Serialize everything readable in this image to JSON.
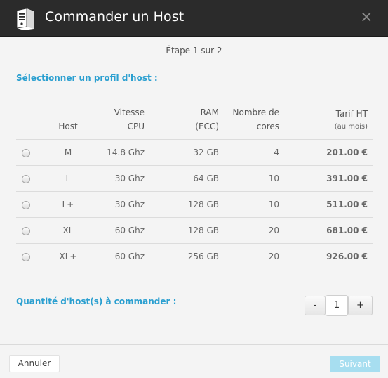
{
  "dialog": {
    "title": "Commander un Host",
    "close_icon": "×"
  },
  "step_text": "Étape 1 sur 2",
  "profile_label": "Sélectionner un profil d'host :",
  "table": {
    "headers": {
      "host": "Host",
      "cpu_line1": "Vitesse",
      "cpu_line2": "CPU",
      "ram_line1": "RAM",
      "ram_line2": "(ECC)",
      "cores_line1": "Nombre de",
      "cores_line2": "cores",
      "price_line1": "Tarif HT",
      "price_line2": "(au mois)"
    },
    "rows": [
      {
        "host": "M",
        "cpu": "14.8 Ghz",
        "ram": "32 GB",
        "cores": "4",
        "price": "201.00 €"
      },
      {
        "host": "L",
        "cpu": "30 Ghz",
        "ram": "64 GB",
        "cores": "10",
        "price": "391.00 €"
      },
      {
        "host": "L+",
        "cpu": "30 Ghz",
        "ram": "128 GB",
        "cores": "10",
        "price": "511.00 €"
      },
      {
        "host": "XL",
        "cpu": "60 Ghz",
        "ram": "128 GB",
        "cores": "20",
        "price": "681.00 €"
      },
      {
        "host": "XL+",
        "cpu": "60 Ghz",
        "ram": "256 GB",
        "cores": "20",
        "price": "926.00 €"
      }
    ]
  },
  "quantity": {
    "label": "Quantité d'host(s) à commander :",
    "minus": "-",
    "value": "1",
    "plus": "+"
  },
  "footer": {
    "cancel": "Annuler",
    "next": "Suivant"
  },
  "colors": {
    "accent": "#2a9fd0",
    "price": "#d0021b",
    "header_bg": "#2b2b2b",
    "next_disabled": "#a7def0"
  }
}
